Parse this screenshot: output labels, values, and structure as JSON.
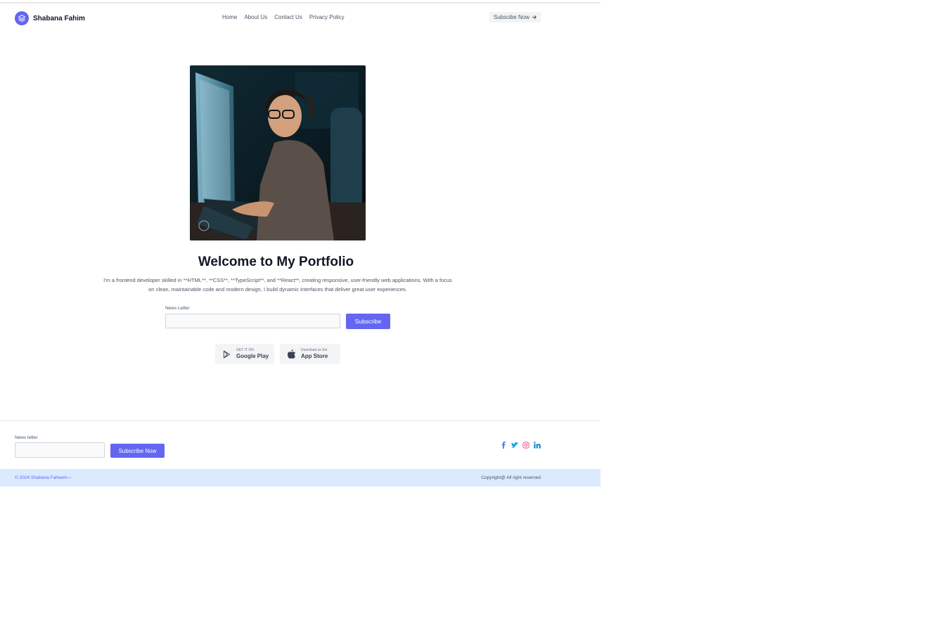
{
  "header": {
    "brand_name": "Shabana Fahim",
    "nav": [
      "Home",
      "About Us",
      "Contact Us",
      "Privacy Policy"
    ],
    "cta_label": "Subscibe Now"
  },
  "hero": {
    "title": "Welcome to My Portfolio",
    "description": "I'm a frontend developer skilled in **HTML**, **CSS**, **TypeScript**, and **React**, creating responsive, user-friendly web applications. With a focus on clean, maintainable code and modern design, I build dynamic interfaces that deliver great user experiences.",
    "newsletter_label": "News Letter",
    "newsletter_value": "",
    "subscribe_label": "Subscribe",
    "google_play": {
      "small": "GET IT ON",
      "big": "Google Play"
    },
    "app_store": {
      "small": "Download on the",
      "big": "App Store"
    }
  },
  "footer": {
    "newsletter_label": "News letter",
    "newsletter_value": "",
    "subscribe_label": "Subscribe Now",
    "socials": [
      "facebook-icon",
      "twitter-icon",
      "instagram-icon",
      "linkedin-icon"
    ],
    "copyright_left": "© 2024 Shabana Faheem—",
    "copyright_right": "Copyright@ All right reserved"
  },
  "colors": {
    "accent": "#6366f1",
    "footer_bar": "#dbeafe"
  }
}
